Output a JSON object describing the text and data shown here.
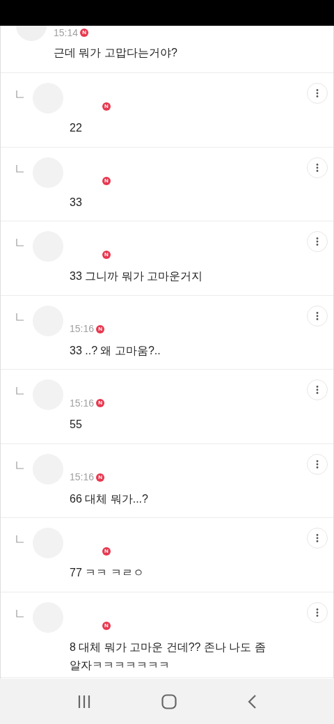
{
  "top_comment": {
    "time": "15:14",
    "badge": "N",
    "text": "근데 뭐가 고맙다는거야?"
  },
  "replies": [
    {
      "badge": "N",
      "text": "22"
    },
    {
      "badge": "N",
      "text": "33"
    },
    {
      "badge": "N",
      "text": "33 그니까 뭐가 고마운거지"
    },
    {
      "time": "15:16",
      "badge": "N",
      "text": "33 ..? 왜 고마움?.."
    },
    {
      "time": "15:16",
      "badge": "N",
      "text": "55"
    },
    {
      "time": "15:16",
      "badge": "N",
      "text": "66 대체 뭐가...?"
    },
    {
      "badge": "N",
      "text": "77 ㅋㅋ ㅋㄹㅇ"
    },
    {
      "badge": "N",
      "text": "8 대체 뭐가 고마운 건데?? 존나 나도 좀 알자ㅋㅋㅋㅋㅋㅋㅋ"
    }
  ]
}
